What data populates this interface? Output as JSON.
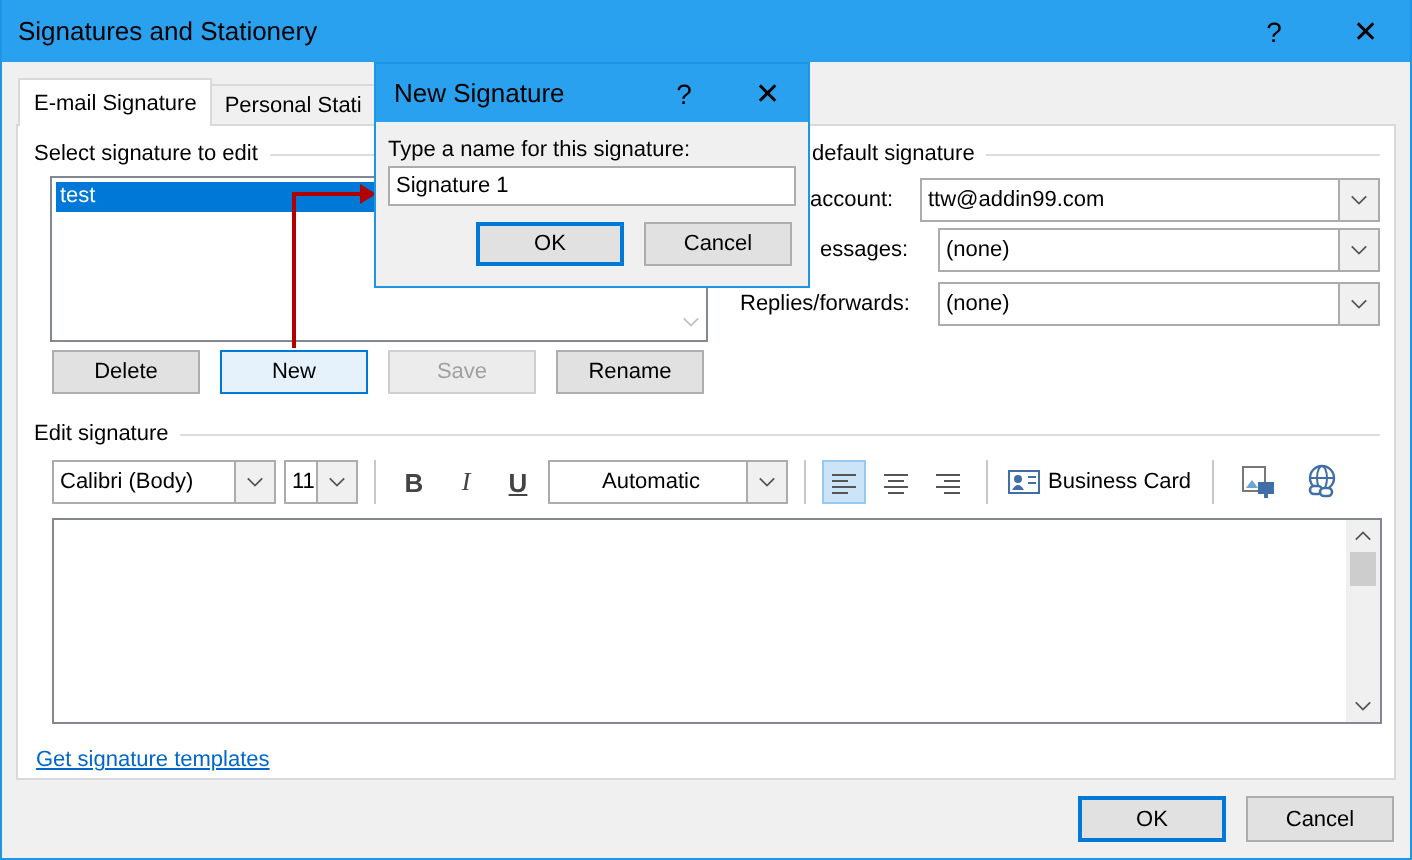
{
  "window": {
    "title": "Signatures and Stationery",
    "help": "?",
    "close": "✕"
  },
  "tabs": [
    {
      "label": "E-mail Signature",
      "selected": true
    },
    {
      "label": "Personal Stati",
      "selected": false
    }
  ],
  "signature_list": {
    "label": "Select signature to edit",
    "items": [
      {
        "label": "test",
        "selected": true
      }
    ]
  },
  "list_buttons": [
    {
      "label": "Delete",
      "disabled": false,
      "focused": false
    },
    {
      "label": "New",
      "disabled": false,
      "focused": true
    },
    {
      "label": "Save",
      "disabled": true,
      "focused": false
    },
    {
      "label": "Rename",
      "disabled": false,
      "focused": false
    }
  ],
  "default_signature": {
    "heading": "default signature",
    "fields": [
      {
        "label": "account:",
        "value": "ttw@addin99.com"
      },
      {
        "label": "essages:",
        "value": "(none)"
      },
      {
        "label": "Replies/forwards:",
        "value": "(none)"
      }
    ]
  },
  "edit_signature": {
    "label": "Edit signature",
    "font": "Calibri (Body)",
    "size": "11",
    "swatch_text": "Automatic",
    "business_card": "Business Card",
    "styles": [
      {
        "kind": "bold",
        "label": "B"
      },
      {
        "kind": "italic",
        "label": "I"
      },
      {
        "kind": "underline",
        "label": "U"
      }
    ],
    "alignments": [
      {
        "kind": "left",
        "selected": true
      },
      {
        "kind": "center",
        "selected": false
      },
      {
        "kind": "right",
        "selected": false
      }
    ]
  },
  "templates_link": "Get signature templates",
  "buttons": [
    {
      "label": "OK",
      "default": true
    },
    {
      "label": "Cancel",
      "default": false
    }
  ],
  "popup": {
    "title": "New Signature",
    "help": "?",
    "close": "✕",
    "prompt": "Type a name for this signature:",
    "value": "Signature 1",
    "buttons": [
      {
        "label": "OK",
        "default": true
      },
      {
        "label": "Cancel",
        "default": false
      }
    ]
  }
}
